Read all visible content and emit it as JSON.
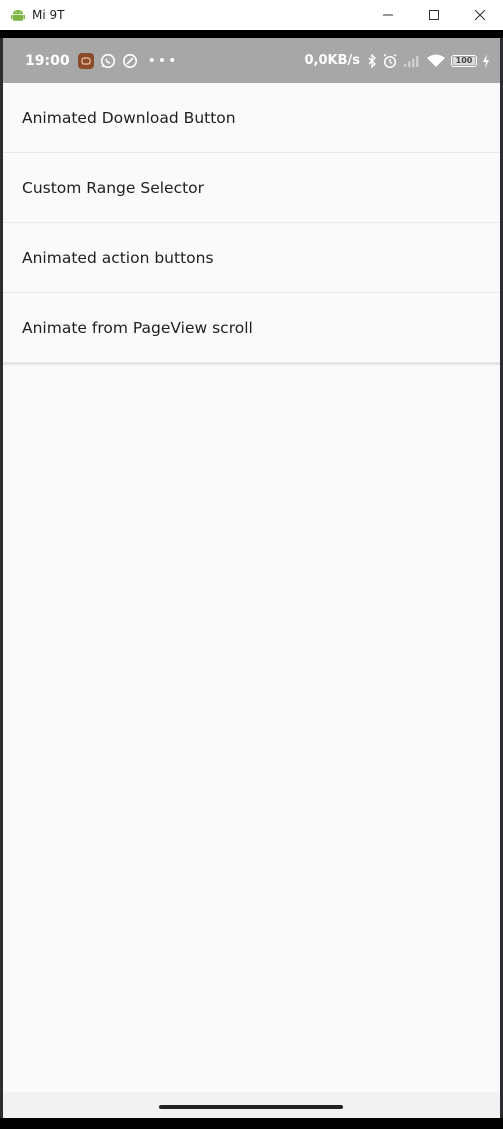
{
  "window": {
    "title": "Mi 9T",
    "icon": "android-icon"
  },
  "statusbar": {
    "time": "19:00",
    "network_speed": "0,0KB/s",
    "battery_level": "100",
    "dots": "•••"
  },
  "list": {
    "items": [
      {
        "label": "Animated Download Button"
      },
      {
        "label": "Custom Range Selector"
      },
      {
        "label": "Animated action buttons"
      },
      {
        "label": "Animate from PageView scroll"
      }
    ]
  },
  "colors": {
    "statusbar_bg": "#a7a7a7",
    "screen_bg": "#fafafa",
    "android_green": "#7cb342"
  }
}
